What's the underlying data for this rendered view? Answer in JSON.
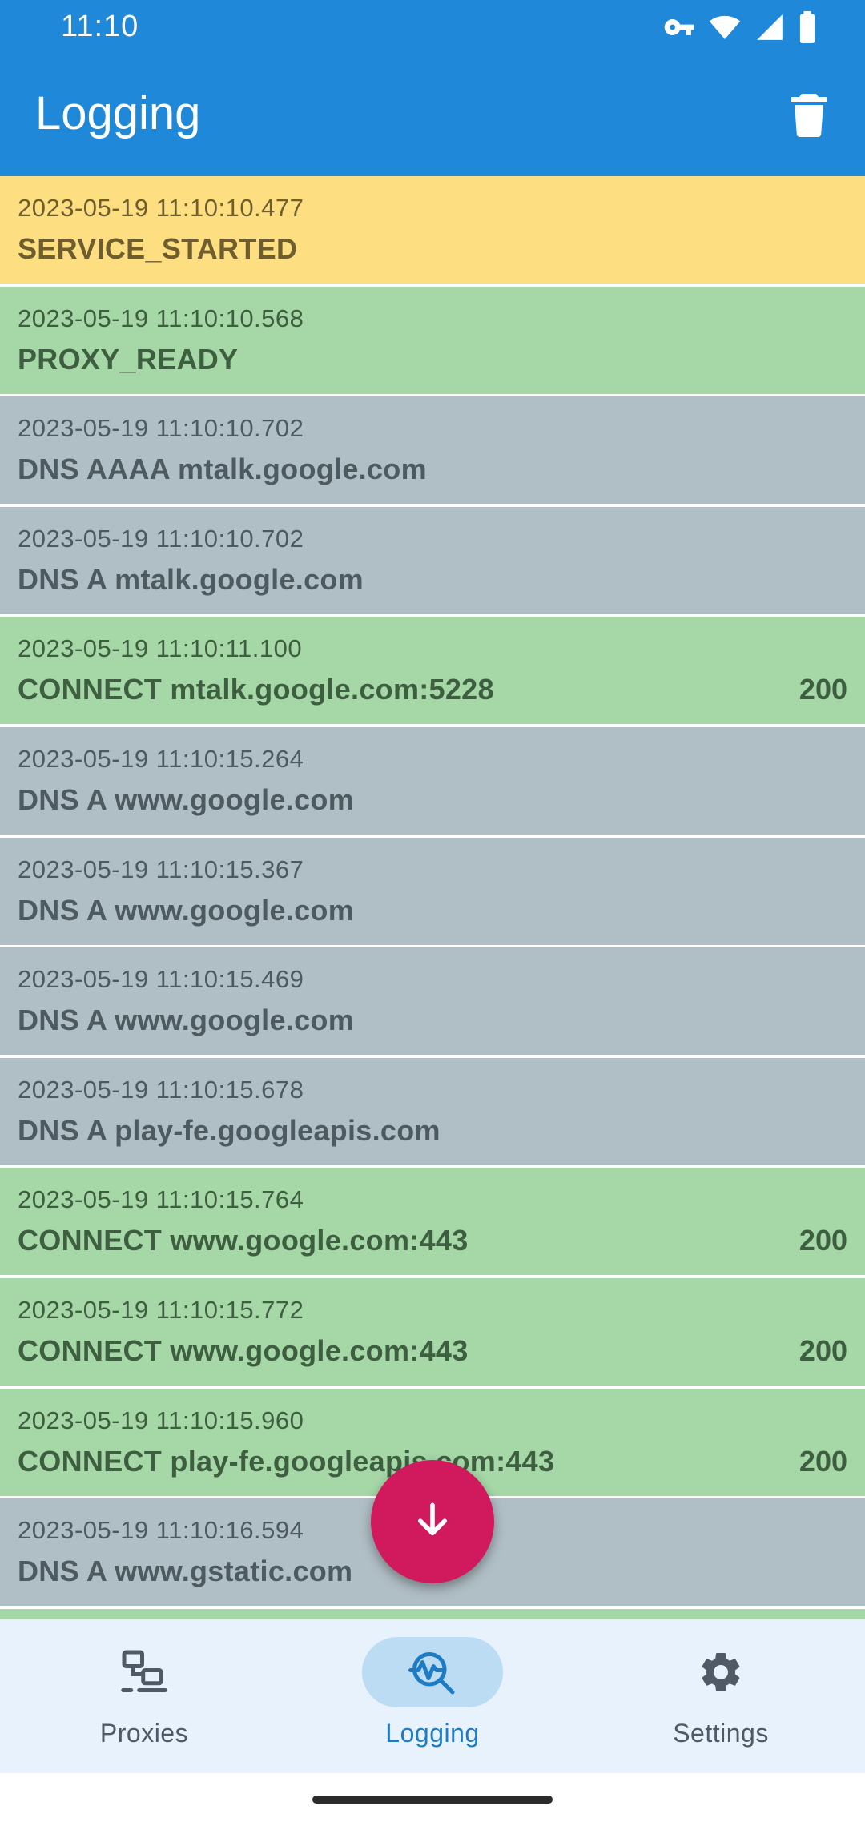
{
  "status_bar": {
    "time": "11:10",
    "icons": [
      "vpn-key-icon",
      "wifi-icon",
      "cellular-signal-icon",
      "battery-icon"
    ]
  },
  "app_bar": {
    "title": "Logging",
    "action_icon": "delete-icon"
  },
  "colors": {
    "primary": "#2088d8",
    "started": "#fdde80",
    "success": "#a5d7a7",
    "dns": "#b0bec5",
    "accent": "#d11a5d",
    "nav_background": "#e8f2fc",
    "nav_active": "#1e7cc4",
    "nav_inactive": "#4f5a66",
    "nav_indicator": "#bcdcf4"
  },
  "log": {
    "entries": [
      {
        "time": "2023-05-19 11:10:10.477",
        "message": "SERVICE_STARTED",
        "status": "",
        "kind": "started"
      },
      {
        "time": "2023-05-19 11:10:10.568",
        "message": "PROXY_READY",
        "status": "",
        "kind": "success"
      },
      {
        "time": "2023-05-19 11:10:10.702",
        "message": "DNS AAAA mtalk.google.com",
        "status": "",
        "kind": "dns"
      },
      {
        "time": "2023-05-19 11:10:10.702",
        "message": "DNS A mtalk.google.com",
        "status": "",
        "kind": "dns"
      },
      {
        "time": "2023-05-19 11:10:11.100",
        "message": "CONNECT mtalk.google.com:5228",
        "status": "200",
        "kind": "success"
      },
      {
        "time": "2023-05-19 11:10:15.264",
        "message": "DNS A www.google.com",
        "status": "",
        "kind": "dns"
      },
      {
        "time": "2023-05-19 11:10:15.367",
        "message": "DNS A www.google.com",
        "status": "",
        "kind": "dns"
      },
      {
        "time": "2023-05-19 11:10:15.469",
        "message": "DNS A www.google.com",
        "status": "",
        "kind": "dns"
      },
      {
        "time": "2023-05-19 11:10:15.678",
        "message": "DNS A play-fe.googleapis.com",
        "status": "",
        "kind": "dns"
      },
      {
        "time": "2023-05-19 11:10:15.764",
        "message": "CONNECT www.google.com:443",
        "status": "200",
        "kind": "success"
      },
      {
        "time": "2023-05-19 11:10:15.772",
        "message": "CONNECT www.google.com:443",
        "status": "200",
        "kind": "success"
      },
      {
        "time": "2023-05-19 11:10:15.960",
        "message": "CONNECT play-fe.googleapis.com:443",
        "status": "200",
        "kind": "success"
      },
      {
        "time": "2023-05-19 11:10:16.594",
        "message": "DNS A www.gstatic.com",
        "status": "",
        "kind": "dns"
      },
      {
        "time": "",
        "message": "",
        "status": "",
        "kind": "success"
      }
    ]
  },
  "fab": {
    "icon": "arrow-down-icon"
  },
  "bottom_nav": {
    "active": "logging",
    "items": [
      {
        "id": "proxies",
        "label": "Proxies",
        "icon": "proxies-network-icon"
      },
      {
        "id": "logging",
        "label": "Logging",
        "icon": "logging-monitor-icon"
      },
      {
        "id": "settings",
        "label": "Settings",
        "icon": "settings-gear-icon"
      }
    ]
  }
}
